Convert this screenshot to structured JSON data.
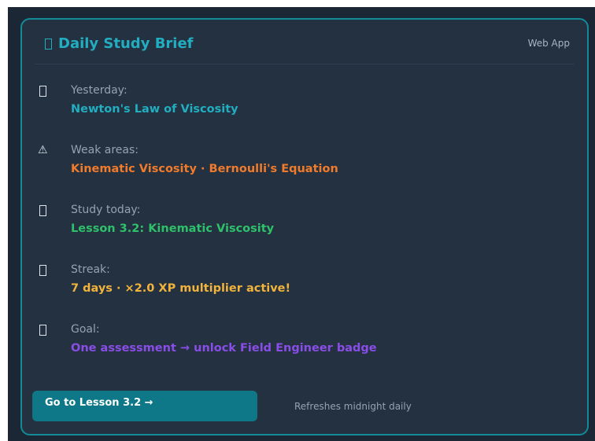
{
  "card": {
    "title": "Daily Study Brief",
    "title_icon": "document-icon",
    "header_tag": "Web App"
  },
  "rows": [
    {
      "icon": "document-icon",
      "label": "Yesterday:",
      "value": "Newton's Law of Viscosity",
      "color": "#22aec0"
    },
    {
      "icon": "warning-icon",
      "label": "Weak areas:",
      "value": "Kinematic Viscosity · Bernoulli's Equation",
      "color": "#f07b2c"
    },
    {
      "icon": "document-icon",
      "label": "Study today:",
      "value": "Lesson 3.2: Kinematic Viscosity",
      "color": "#2fc06a"
    },
    {
      "icon": "document-icon",
      "label": "Streak:",
      "value": "7 days  ·  ×2.0 XP multiplier active!",
      "color": "#f2b33d"
    },
    {
      "icon": "document-icon",
      "label": "Goal:",
      "value": "One assessment → unlock Field Engineer badge",
      "color": "#8a4de8"
    }
  ],
  "footer": {
    "cta_label": "Go to Lesson 3.2 →",
    "refresh_note": "Refreshes midnight daily"
  },
  "colors": {
    "accent": "#22aec0",
    "card_border": "#138a98",
    "card_bg": "#233140",
    "cta_bg": "#0e7888"
  }
}
